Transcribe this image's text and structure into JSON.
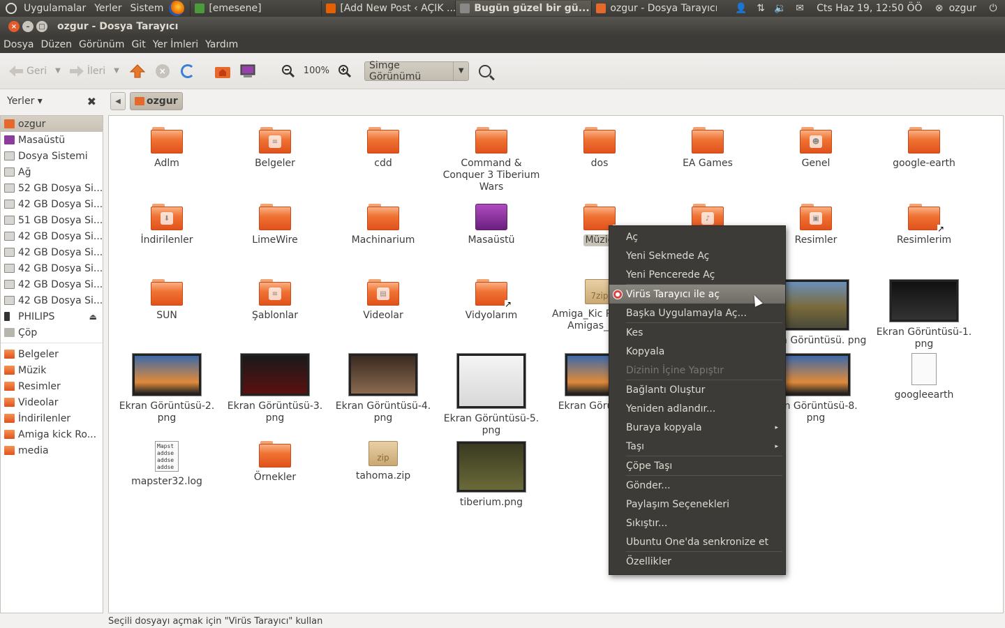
{
  "top_panel": {
    "menus": [
      "Uygulamalar",
      "Yerler",
      "Sistem"
    ],
    "tasks": [
      {
        "label": "[emesene]",
        "active": false,
        "color": "#4a9c3a"
      },
      {
        "label": "[Add New Post ‹ AÇIK ...",
        "active": false,
        "color": "#e66000"
      },
      {
        "label": "Bugün güzel bir gü...",
        "active": true,
        "color": "#888888"
      },
      {
        "label": "ozgur - Dosya Tarayıcı",
        "active": false,
        "color": "#e4692a"
      }
    ],
    "clock": "Cts Haz 19, 12:50 ÖÖ",
    "user": "ozgur"
  },
  "window": {
    "title": "ozgur - Dosya Tarayıcı"
  },
  "menubar": [
    "Dosya",
    "Düzen",
    "Görünüm",
    "Git",
    "Yer İmleri",
    "Yardım"
  ],
  "toolbar": {
    "back_label": "Geri",
    "forward_label": "İleri",
    "zoom_level": "100%",
    "view_mode": "Simge Görünümü"
  },
  "sidebar": {
    "header": "Yerler",
    "places": [
      {
        "label": "ozgur",
        "icon": "home",
        "selected": true
      },
      {
        "label": "Masaüstü",
        "icon": "desk"
      },
      {
        "label": "Dosya Sistemi",
        "icon": "disk"
      },
      {
        "label": "Ağ",
        "icon": "disk"
      },
      {
        "label": "52 GB Dosya Si...",
        "icon": "disk"
      },
      {
        "label": "42 GB Dosya Si...",
        "icon": "disk"
      },
      {
        "label": "51 GB Dosya Si...",
        "icon": "disk"
      },
      {
        "label": "42 GB Dosya Si...",
        "icon": "disk"
      },
      {
        "label": "42 GB Dosya Si...",
        "icon": "disk"
      },
      {
        "label": "42 GB Dosya Si...",
        "icon": "disk"
      },
      {
        "label": "42 GB Dosya Si...",
        "icon": "disk"
      },
      {
        "label": "42 GB Dosya Si...",
        "icon": "disk"
      },
      {
        "label": "PHILIPS",
        "icon": "usb",
        "eject": true
      },
      {
        "label": "Çöp",
        "icon": "trash"
      }
    ],
    "bookmarks": [
      {
        "label": "Belgeler",
        "icon": "folder"
      },
      {
        "label": "Müzik",
        "icon": "folder"
      },
      {
        "label": "Resimler",
        "icon": "folder"
      },
      {
        "label": "Videolar",
        "icon": "folder"
      },
      {
        "label": "İndirilenler",
        "icon": "folder"
      },
      {
        "label": "Amiga kick Ro...",
        "icon": "folder"
      },
      {
        "label": "media",
        "icon": "folder"
      }
    ]
  },
  "pathbar": {
    "current": "ozgur"
  },
  "files": [
    {
      "name": "Adlm",
      "kind": "folder",
      "col": 0,
      "row": 0
    },
    {
      "name": "Belgeler",
      "kind": "folder",
      "emblem": "doc",
      "col": 1,
      "row": 0
    },
    {
      "name": "cdd",
      "kind": "folder",
      "col": 2,
      "row": 0
    },
    {
      "name": "Command & Conquer 3 Tiberium Wars",
      "kind": "folder",
      "col": 3,
      "row": 0
    },
    {
      "name": "dos",
      "kind": "folder",
      "col": 4,
      "row": 0
    },
    {
      "name": "EA Games",
      "kind": "folder",
      "col": 5,
      "row": 0
    },
    {
      "name": "Genel",
      "kind": "folder",
      "emblem": "person",
      "col": 6,
      "row": 0
    },
    {
      "name": "google-earth",
      "kind": "folder",
      "col": 7,
      "row": 0
    },
    {
      "name": "İndirilenler",
      "kind": "folder",
      "emblem": "down",
      "col": 0,
      "row": 1
    },
    {
      "name": "LimeWire",
      "kind": "folder",
      "col": 1,
      "row": 1
    },
    {
      "name": "Machinarium",
      "kind": "folder",
      "col": 2,
      "row": 1
    },
    {
      "name": "Masaüstü",
      "kind": "desktop",
      "col": 3,
      "row": 1
    },
    {
      "name": "Müziğ",
      "kind": "folder",
      "selected": true,
      "link": true,
      "col": 4,
      "row": 1
    },
    {
      "name": "",
      "kind": "folder",
      "emblem": "music",
      "col": 5,
      "row": 1
    },
    {
      "name": "Resimler",
      "kind": "folder",
      "emblem": "pic",
      "col": 6,
      "row": 1
    },
    {
      "name": "Resimlerim",
      "kind": "folder",
      "link": true,
      "col": 7,
      "row": 1
    },
    {
      "name": "SUN",
      "kind": "folder",
      "col": 0,
      "row": 2
    },
    {
      "name": "Şablonlar",
      "kind": "folder",
      "emblem": "doc",
      "col": 1,
      "row": 2
    },
    {
      "name": "Videolar",
      "kind": "folder",
      "emblem": "film",
      "col": 2,
      "row": 2
    },
    {
      "name": "Vidyolarım",
      "kind": "folder",
      "link": true,
      "col": 3,
      "row": 2
    },
    {
      "name": "Amiga_Kic ROMs_-_ Amigas_(A10",
      "kind": "zip",
      "zip_label": "7zip",
      "col": 4,
      "row": 2
    },
    {
      "name": "kran Görüntüsü. png",
      "kind": "thumb",
      "thumb": "game",
      "col": 6,
      "row": 2
    },
    {
      "name": "Ekran Görüntüsü-1. png",
      "kind": "thumb",
      "thumb": "dark",
      "col": 7,
      "row": 2
    },
    {
      "name": "Ekran Görüntüsü-2. png",
      "kind": "thumb",
      "thumb": "desktop",
      "col": 0,
      "row": 3
    },
    {
      "name": "Ekran Görüntüsü-3. png",
      "kind": "thumb",
      "thumb": "dark2",
      "col": 1,
      "row": 3
    },
    {
      "name": "Ekran Görüntüsü-4. png",
      "kind": "thumb",
      "thumb": "brown",
      "col": 2,
      "row": 3
    },
    {
      "name": "Ekran Görüntüsü-5. png",
      "kind": "thumb",
      "thumb": "window",
      "col": 3,
      "row": 3
    },
    {
      "name": "Ekran Görün png",
      "kind": "thumb",
      "thumb": "desktop",
      "col": 4,
      "row": 3
    },
    {
      "name": "ran Görüntüsü-8. png",
      "kind": "thumb",
      "thumb": "desktop",
      "col": 6,
      "row": 3
    },
    {
      "name": "googleearth",
      "kind": "doc",
      "link": true,
      "col": 7,
      "row": 3
    },
    {
      "name": "mapster32.log",
      "kind": "log",
      "text": "Mapst addse addse addse",
      "col": 0,
      "row": 4
    },
    {
      "name": "Örnekler",
      "kind": "folder",
      "col": 1,
      "row": 4
    },
    {
      "name": "tahoma.zip",
      "kind": "zip",
      "zip_label": "zip",
      "col": 2,
      "row": 4
    },
    {
      "name": "tiberium.png",
      "kind": "thumb",
      "thumb": "map",
      "col": 3,
      "row": 4
    }
  ],
  "context_menu": [
    {
      "label": "Aç"
    },
    {
      "label": "Yeni Sekmede Aç"
    },
    {
      "label": "Yeni Pencerede Aç"
    },
    {
      "sep": true
    },
    {
      "label": "Virüs Tarayıcı ile aç",
      "highlight": true,
      "icon": true
    },
    {
      "label": "Başka Uygulamayla Aç..."
    },
    {
      "sep": true
    },
    {
      "label": "Kes"
    },
    {
      "label": "Kopyala"
    },
    {
      "label": "Dizinin İçine Yapıştır",
      "disabled": true
    },
    {
      "sep": true
    },
    {
      "label": "Bağlantı Oluştur"
    },
    {
      "label": "Yeniden adlandır..."
    },
    {
      "label": "Buraya kopyala",
      "submenu": true
    },
    {
      "label": "Taşı",
      "submenu": true
    },
    {
      "sep": true
    },
    {
      "label": "Çöpe Taşı"
    },
    {
      "sep": true
    },
    {
      "label": "Gönder..."
    },
    {
      "label": "Paylaşım Seçenekleri"
    },
    {
      "label": "Sıkıştır..."
    },
    {
      "label": "Ubuntu One'da senkronize et"
    },
    {
      "sep": true
    },
    {
      "label": "Özellikler"
    }
  ],
  "statusbar": "Seçili dosyayı açmak için \"Virüs Tarayıcı\" kullan"
}
